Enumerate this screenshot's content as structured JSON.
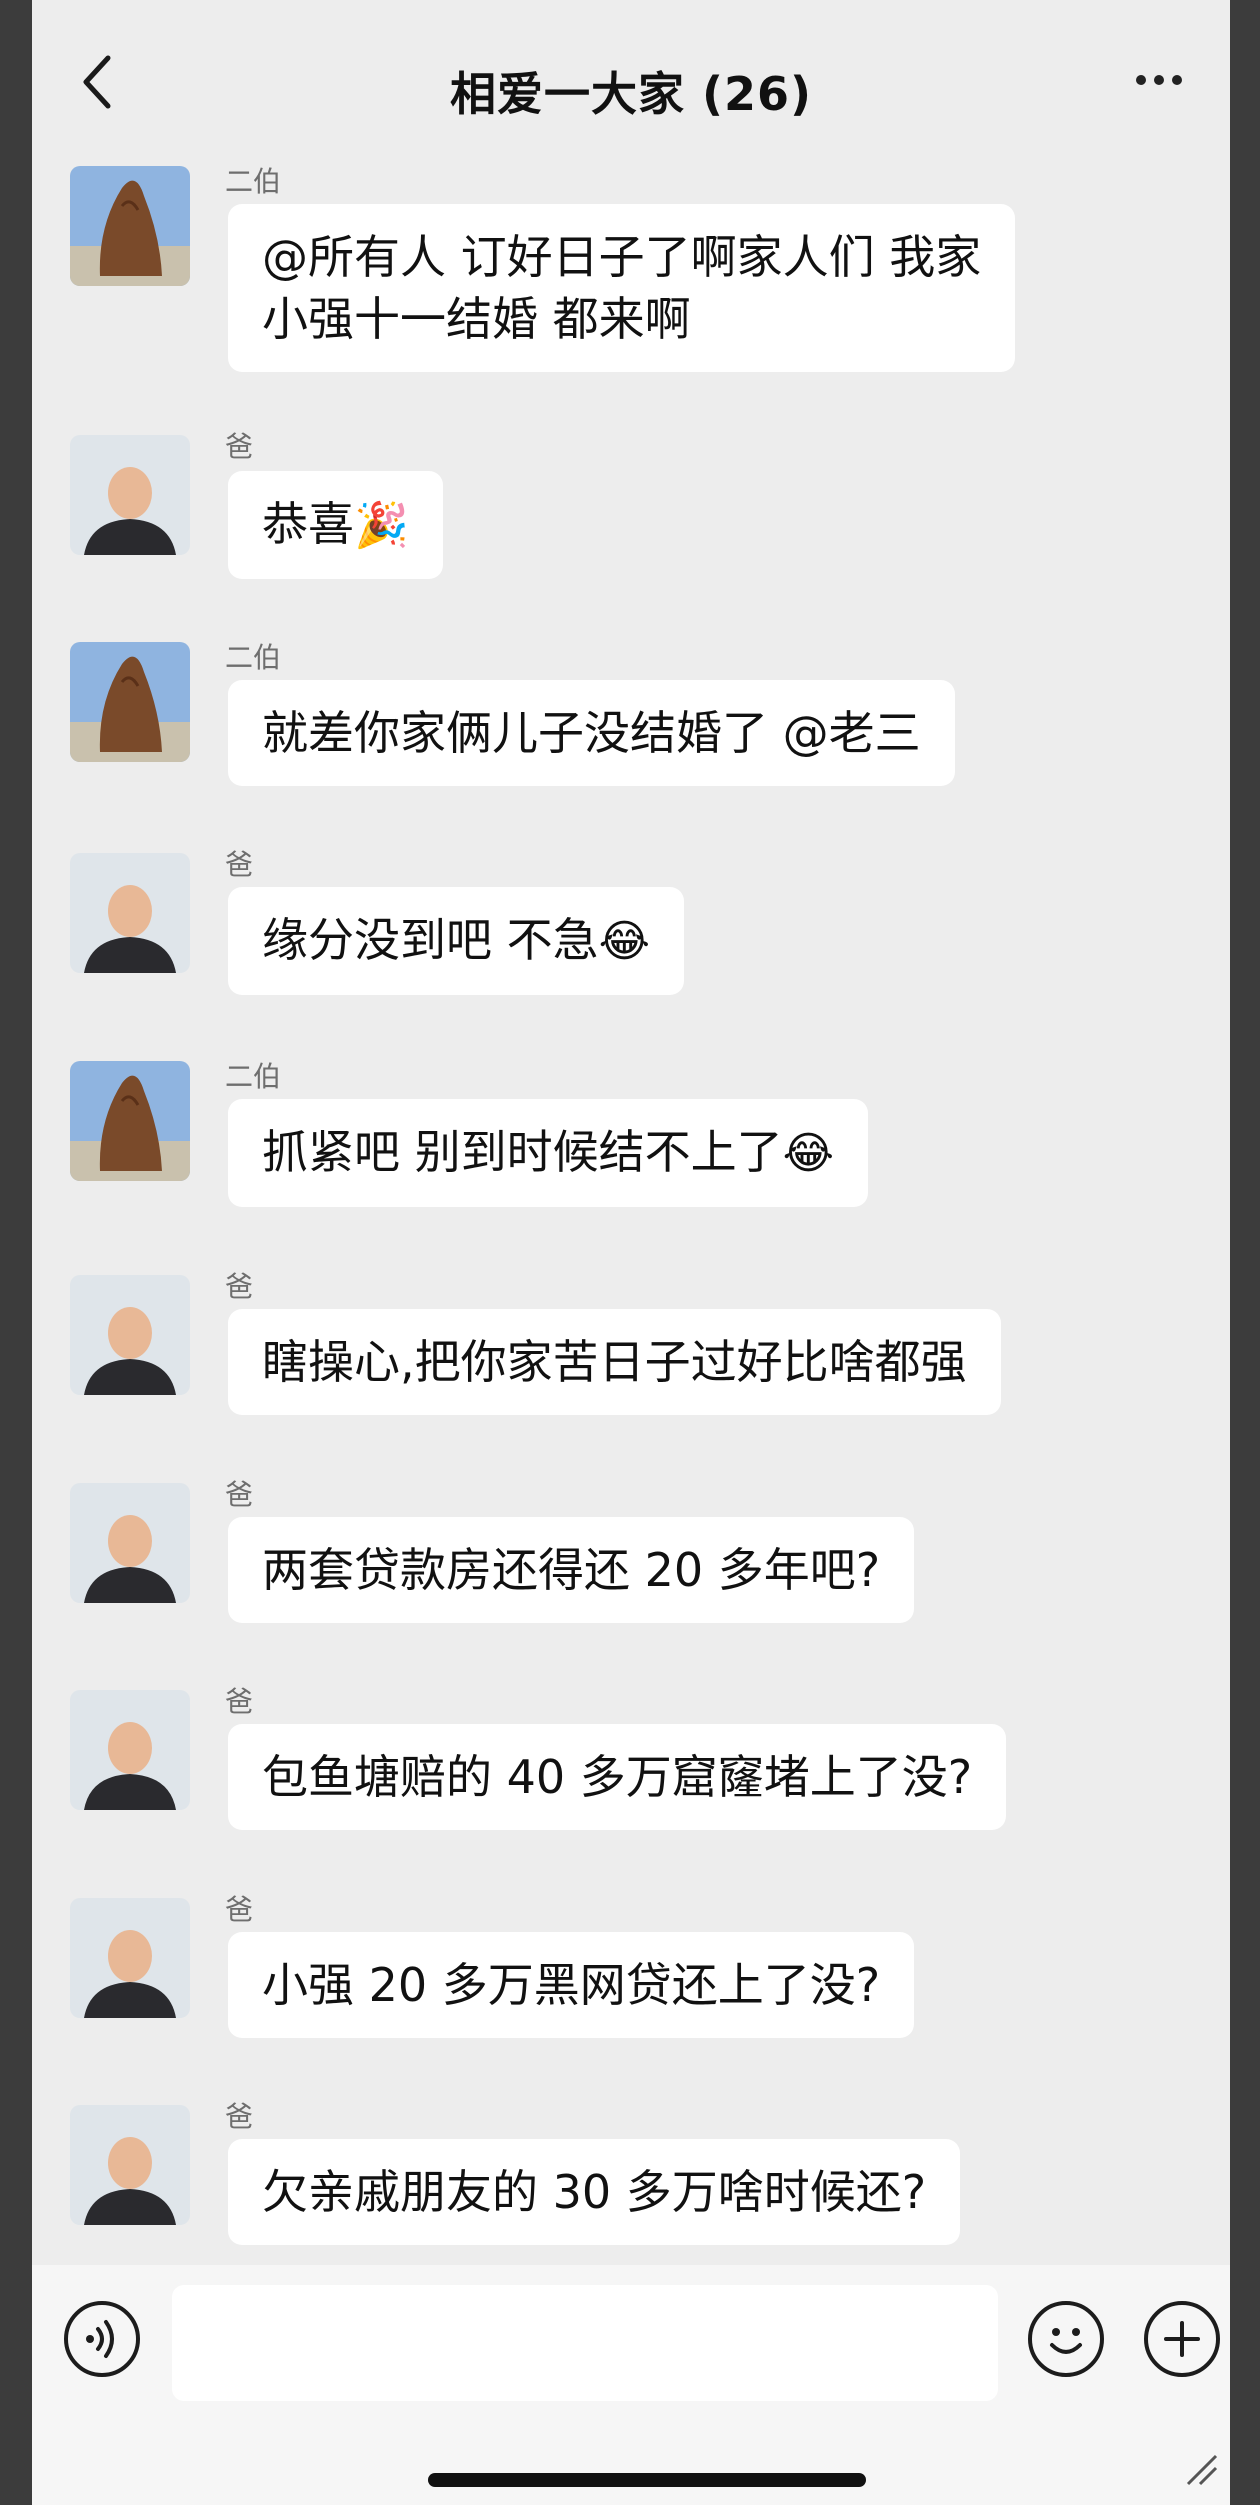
{
  "header": {
    "title": "相爱一大家 (26)"
  },
  "messages": [
    {
      "sender": "二伯",
      "avatar": "rock-avatar",
      "text_lines": [
        "@所有人 订好日子了啊家人们 我家",
        "小强十一结婚  都来啊"
      ],
      "emoji": ""
    },
    {
      "sender": "爸",
      "avatar": "man-avatar",
      "text": "恭喜",
      "emoji": "🎉"
    },
    {
      "sender": "二伯",
      "avatar": "rock-avatar",
      "text": "就差你家俩儿子没结婚了 @老三",
      "emoji": ""
    },
    {
      "sender": "爸",
      "avatar": "man-avatar",
      "text": "缘分没到吧 不急",
      "emoji": "😂"
    },
    {
      "sender": "二伯",
      "avatar": "rock-avatar",
      "text": "抓紧吧 别到时候结不上了",
      "emoji": "😂"
    },
    {
      "sender": "爸",
      "avatar": "man-avatar",
      "text": "瞎操心,把你家苦日子过好比啥都强",
      "emoji": ""
    },
    {
      "sender": "爸",
      "avatar": "man-avatar",
      "text": "两套贷款房还得还 20 多年吧?",
      "emoji": ""
    },
    {
      "sender": "爸",
      "avatar": "man-avatar",
      "text": "包鱼塘赔的 40 多万窟窿堵上了没?",
      "emoji": ""
    },
    {
      "sender": "爸",
      "avatar": "man-avatar",
      "text": "小强 20 多万黑网贷还上了没?",
      "emoji": ""
    },
    {
      "sender": "爸",
      "avatar": "man-avatar",
      "text": "欠亲戚朋友的 30 多万啥时候还?",
      "emoji": ""
    }
  ],
  "input_bar": {
    "voice_icon": "voice-icon",
    "emoji_icon": "emoji-icon",
    "plus_icon": "plus-icon",
    "input_value": ""
  },
  "colors": {
    "background": "#ededed",
    "bubble": "#ffffff",
    "sender_text": "#6e6e6e"
  }
}
